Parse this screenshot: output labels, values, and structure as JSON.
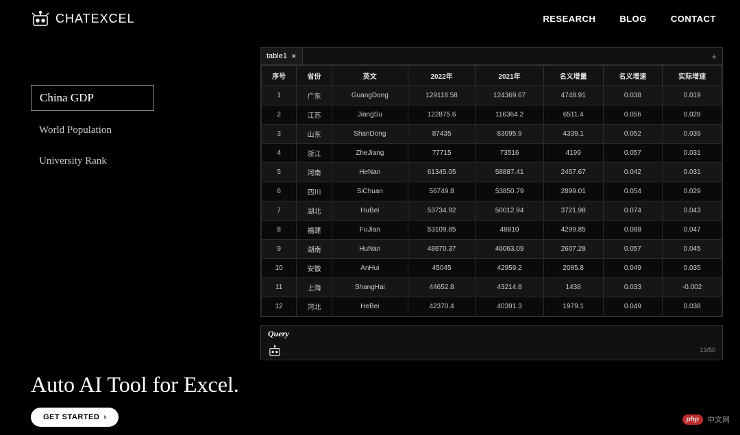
{
  "brand": "CHATEXCEL",
  "nav": [
    "RESEARCH",
    "BLOG",
    "CONTACT"
  ],
  "sidebar": {
    "items": [
      {
        "label": "China GDP",
        "active": true
      },
      {
        "label": "World Population",
        "active": false
      },
      {
        "label": "University Rank",
        "active": false
      }
    ]
  },
  "tab": {
    "label": "table1"
  },
  "table": {
    "headers": [
      "序号",
      "省份",
      "英文",
      "2022年",
      "2021年",
      "名义增量",
      "名义增速",
      "实际增速"
    ],
    "rows": [
      [
        "1",
        "广东",
        "GuangDong",
        "129118.58",
        "124369.67",
        "4748.91",
        "0.038",
        "0.019"
      ],
      [
        "2",
        "江苏",
        "JiangSu",
        "122875.6",
        "116364.2",
        "6511.4",
        "0.056",
        "0.028"
      ],
      [
        "3",
        "山东",
        "ShanDong",
        "87435",
        "83095.9",
        "4339.1",
        "0.052",
        "0.039"
      ],
      [
        "4",
        "浙江",
        "ZheJiang",
        "77715",
        "73516",
        "4199",
        "0.057",
        "0.031"
      ],
      [
        "5",
        "河南",
        "HeNan",
        "61345.05",
        "58887.41",
        "2457.67",
        "0.042",
        "0.031"
      ],
      [
        "6",
        "四川",
        "SiChuan",
        "56749.8",
        "53850.79",
        "2899.01",
        "0.054",
        "0.029"
      ],
      [
        "7",
        "湖北",
        "HuBei",
        "53734.92",
        "50012.94",
        "3721.98",
        "0.074",
        "0.043"
      ],
      [
        "8",
        "福建",
        "FuJian",
        "53109.85",
        "48810",
        "4299.85",
        "0.088",
        "0.047"
      ],
      [
        "9",
        "湖南",
        "HuNan",
        "48670.37",
        "46063.09",
        "2607.28",
        "0.057",
        "0.045"
      ],
      [
        "10",
        "安徽",
        "AnHui",
        "45045",
        "42959.2",
        "2085.8",
        "0.049",
        "0.035"
      ],
      [
        "11",
        "上海",
        "ShangHai",
        "44652.8",
        "43214.8",
        "1438",
        "0.033",
        "-0.002"
      ],
      [
        "12",
        "河北",
        "HeBei",
        "42370.4",
        "40391.3",
        "1979.1",
        "0.049",
        "0.038"
      ]
    ]
  },
  "query": {
    "label": "Query",
    "counter": "13/50"
  },
  "headline": "Auto AI Tool for Excel.",
  "cta": "GET STARTED",
  "watermark": {
    "badge": "php",
    "text": "中文网"
  }
}
